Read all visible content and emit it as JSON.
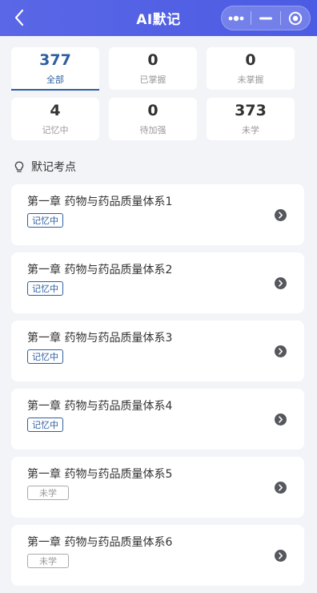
{
  "header": {
    "title": "AI默记"
  },
  "stats": [
    {
      "value": "377",
      "label": "全部",
      "active": true
    },
    {
      "value": "0",
      "label": "已掌握",
      "active": false
    },
    {
      "value": "0",
      "label": "未掌握",
      "active": false
    },
    {
      "value": "4",
      "label": "记忆中",
      "active": false
    },
    {
      "value": "0",
      "label": "待加强",
      "active": false
    },
    {
      "value": "373",
      "label": "未学",
      "active": false
    }
  ],
  "section": {
    "title": "默记考点"
  },
  "chapters": [
    {
      "title": "第一章 药物与药品质量体系1",
      "status": "记忆中"
    },
    {
      "title": "第一章 药物与药品质量体系2",
      "status": "记忆中"
    },
    {
      "title": "第一章 药物与药品质量体系3",
      "status": "记忆中"
    },
    {
      "title": "第一章 药物与药品质量体系4",
      "status": "记忆中"
    },
    {
      "title": "第一章 药物与药品质量体系5",
      "status": "未学"
    },
    {
      "title": "第一章 药物与药品质量体系6",
      "status": "未学"
    }
  ],
  "colors": {
    "header_bg": "#4b5be3",
    "accent": "#2e5fa0",
    "page_bg": "#f3f4f8"
  }
}
